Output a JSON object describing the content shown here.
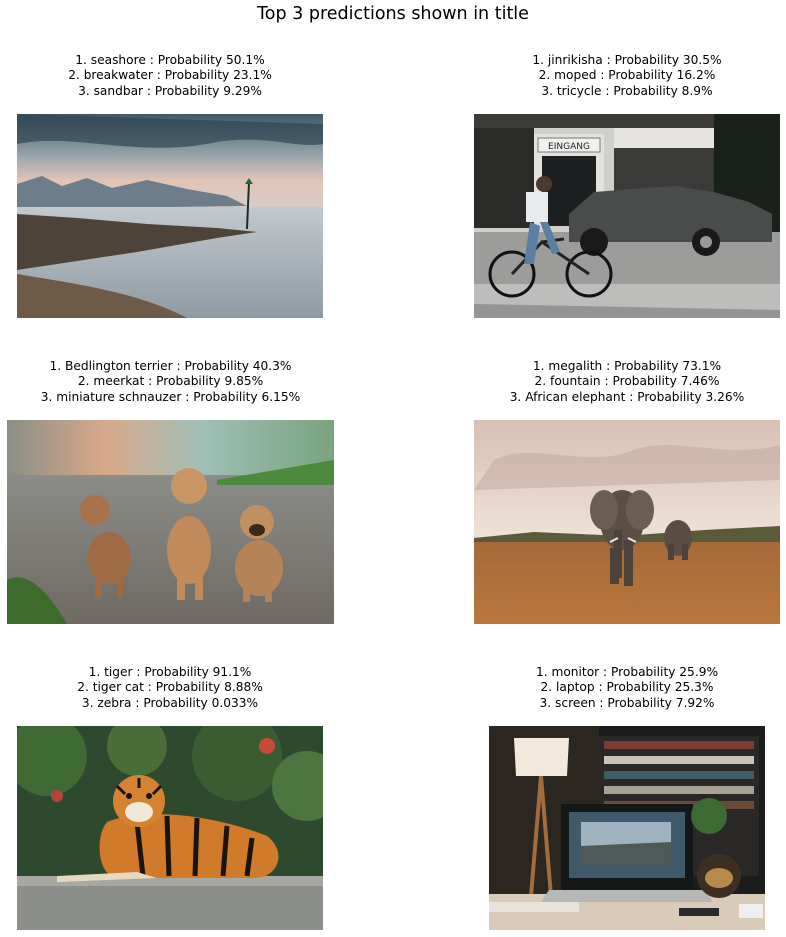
{
  "title": "Top 3 predictions shown in title",
  "panels": [
    {
      "predictions": [
        "1. seashore : Probability 50.1%",
        "2. breakwater : Probability 23.1%",
        "3. sandbar : Probability 9.29%"
      ]
    },
    {
      "predictions": [
        "1. jinrikisha : Probability 30.5%",
        "2. moped : Probability 16.2%",
        "3. tricycle : Probability 8.9%"
      ],
      "sign_text": "EINGANG"
    },
    {
      "predictions": [
        "1. Bedlington terrier : Probability 40.3%",
        "2. meerkat : Probability 9.85%",
        "3. miniature schnauzer : Probability 6.15%"
      ]
    },
    {
      "predictions": [
        "1. megalith : Probability 73.1%",
        "2. fountain : Probability 7.46%",
        "3. African elephant : Probability 3.26%"
      ]
    },
    {
      "predictions": [
        "1. tiger : Probability 91.1%",
        "2. tiger cat : Probability 8.88%",
        "3. zebra : Probability 0.033%"
      ]
    },
    {
      "predictions": [
        "1. monitor : Probability 25.9%",
        "2. laptop : Probability 25.3%",
        "3. screen : Probability 7.92%"
      ]
    }
  ]
}
